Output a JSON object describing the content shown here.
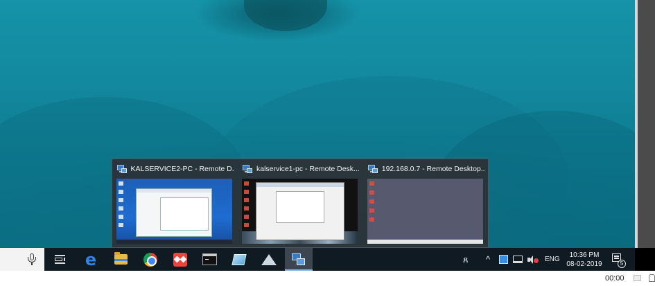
{
  "taskbar": {
    "pinned": [
      {
        "name": "task-view-button",
        "icon": "task-view-icon"
      },
      {
        "name": "edge-button",
        "icon": "edge-icon",
        "glyph": "e"
      },
      {
        "name": "file-explorer-button",
        "icon": "folder-icon"
      },
      {
        "name": "chrome-button",
        "icon": "chrome-icon"
      },
      {
        "name": "anydesk-button",
        "icon": "anydesk-icon"
      },
      {
        "name": "command-prompt-button",
        "icon": "cmd-icon"
      },
      {
        "name": "notepad-button",
        "icon": "notepad-icon"
      },
      {
        "name": "pyramid-app-button",
        "icon": "pyramid-icon"
      },
      {
        "name": "remote-desktop-button",
        "icon": "remote-desktop-icon",
        "active": true
      }
    ],
    "tray": {
      "people_glyph": "ጸ",
      "chevron_glyph": "^",
      "language": "ENG",
      "time": "10:36 PM",
      "date": "08-02-2019",
      "notification_count": "5"
    }
  },
  "flyout": {
    "thumbnails": [
      {
        "title": "KALSERVICE2-PC - Remote D...",
        "preview": "windows-desktop"
      },
      {
        "title": "kalservice1-pc - Remote Desk...",
        "preview": "dark-desktop-with-window"
      },
      {
        "title": "192.168.0.7 - Remote Desktop...",
        "preview": "grey-desktop"
      }
    ]
  },
  "status_bar": {
    "elapsed": "00:00"
  },
  "colors": {
    "wallpaper": "#1593a8",
    "taskbar": "#101a22",
    "active_accent": "#8ab4e8"
  }
}
